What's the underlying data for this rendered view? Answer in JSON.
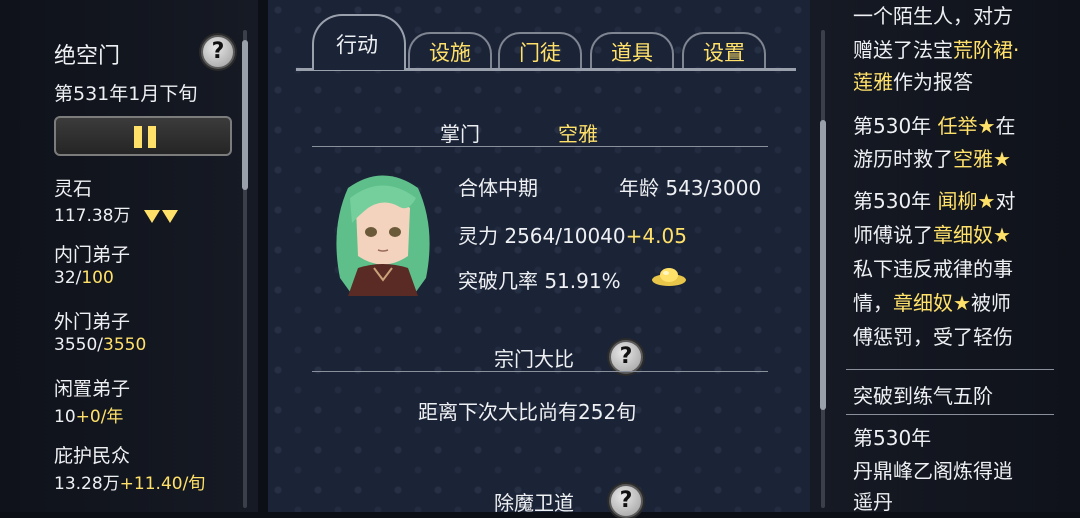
{
  "sidebar": {
    "sect_name": "绝空门",
    "date": "第531年1月下旬",
    "stats": [
      {
        "label": "灵石",
        "value": "117.38万"
      },
      {
        "label": "内门弟子",
        "value_main": "32/",
        "value_accent": "100"
      },
      {
        "label": "外门弟子",
        "value_main": "3550/",
        "value_accent": "3550"
      },
      {
        "label": "闲置弟子",
        "value_main": "10",
        "value_accent": "+0/年"
      },
      {
        "label": "庇护民众",
        "value_main": "13.28万",
        "value_accent": "+11.40/旬"
      }
    ],
    "help_glyph": "?"
  },
  "tabs": [
    {
      "label": "行动",
      "active": true
    },
    {
      "label": "设施",
      "active": false
    },
    {
      "label": "门徒",
      "active": false
    },
    {
      "label": "道具",
      "active": false
    },
    {
      "label": "设置",
      "active": false
    }
  ],
  "leader": {
    "title_label": "掌门",
    "name": "空雅",
    "realm": "合体中期",
    "age_label": "年龄",
    "age_value": "543/3000",
    "spirit_label": "灵力",
    "spirit_value": "2564/10040",
    "spirit_rate": "+4.05",
    "breakthrough_label": "突破几率",
    "breakthrough_value": "51.91%"
  },
  "tournament": {
    "title": "宗门大比",
    "text": "距离下次大比尚有252旬",
    "help_glyph": "?"
  },
  "demon": {
    "title": "除魔卫道",
    "help_glyph": "?"
  },
  "log": {
    "l1": "一个陌生人，对方",
    "l2a": "赠送了法宝",
    "l2b": "荒阶裙·",
    "l3a": "莲雅",
    "l3b": "作为报答",
    "l4a": "第530年",
    "l4b": "任举★",
    "l4c": "在",
    "l5a": "游历时救了",
    "l5b": "空雅★",
    "l6a": "第530年",
    "l6b": "闻柳★",
    "l6c": "对",
    "l7a": "师傅说了",
    "l7b": "章细奴★",
    "l8": "私下违反戒律的事",
    "l9a": "情，",
    "l9b": "章细奴★",
    "l9c": "被师",
    "l10": "傅惩罚，受了轻伤",
    "l11": "突破到练气五阶",
    "l12": "第530年",
    "l13": "丹鼎峰乙阁炼得逍",
    "l14": "遥丹"
  },
  "colors": {
    "accent": "#ffe16a",
    "text": "#eef0f3",
    "panel": "#1b2336"
  }
}
